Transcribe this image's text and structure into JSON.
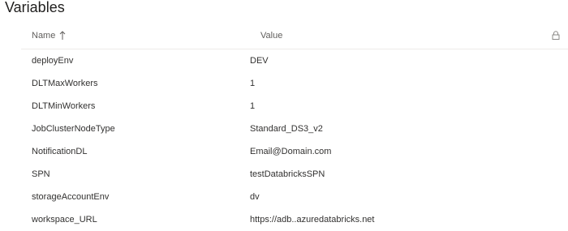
{
  "page": {
    "title": "Variables"
  },
  "table": {
    "columns": {
      "name": "Name",
      "value": "Value"
    },
    "sort_direction": "ascending",
    "lock_icon": "lock-icon",
    "rows": [
      {
        "name": "deployEnv",
        "value": "DEV"
      },
      {
        "name": "DLTMaxWorkers",
        "value": "1"
      },
      {
        "name": "DLTMinWorkers",
        "value": "1"
      },
      {
        "name": "JobClusterNodeType",
        "value": "Standard_DS3_v2"
      },
      {
        "name": "NotificationDL",
        "value": "Email@Domain.com"
      },
      {
        "name": "SPN",
        "value": "testDatabricksSPN"
      },
      {
        "name": "storageAccountEnv",
        "value": "dv"
      },
      {
        "name": "workspace_URL",
        "value": "https://adb..azuredatabricks.net"
      }
    ]
  }
}
